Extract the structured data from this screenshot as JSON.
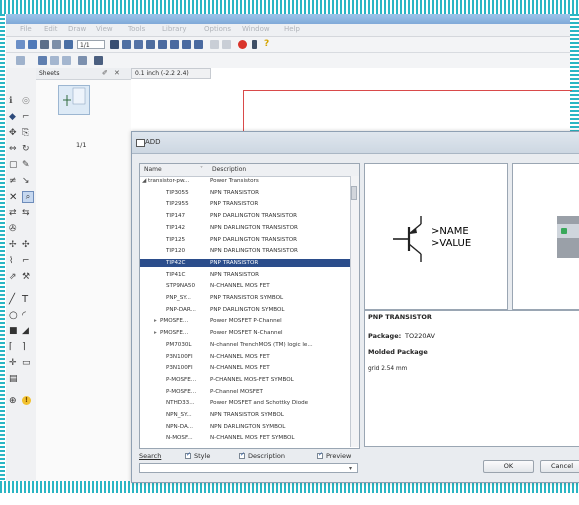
{
  "menu": [
    "File",
    "Edit",
    "Draw",
    "View",
    "Tools",
    "Library",
    "Options",
    "Window",
    "Help"
  ],
  "toolbar": {
    "zoom_value": "1/1"
  },
  "sheets_panel": {
    "title": "Sheets",
    "sheet_number": "1/1"
  },
  "canvas": {
    "coordinate_readout": "0.1 inch (-2.2 2.4)"
  },
  "dialog": {
    "title": "ADD",
    "columns": {
      "name": "Name",
      "description": "Description"
    },
    "rows": [
      {
        "name": "transistor-pw...",
        "description": "Power Transistors",
        "kind": "group"
      },
      {
        "name": "TIP3055",
        "description": "NPN TRANSISTOR"
      },
      {
        "name": "TIP2955",
        "description": "PNP TRANSISTOR"
      },
      {
        "name": "TIP147",
        "description": "PNP DARLINGTON TRANSISTOR"
      },
      {
        "name": "TIP142",
        "description": "NPN DARLINGTON TRANSISTOR"
      },
      {
        "name": "TIP125",
        "description": "PNP DARLINGTON TRANSISTOR"
      },
      {
        "name": "TIP120",
        "description": "NPN DARLINGTON TRANSISTOR"
      },
      {
        "name": "TIP42C",
        "description": "PNP TRANSISTOR",
        "selected": true
      },
      {
        "name": "TIP41C",
        "description": "NPN TRANSISTOR"
      },
      {
        "name": "STP9NA50",
        "description": "N-CHANNEL MOS FET"
      },
      {
        "name": "PNP_SY...",
        "description": "PNP TRANSISTOR SYMBOL"
      },
      {
        "name": "PNP-DAR...",
        "description": "PNP DARLINGTON SYMBOL"
      },
      {
        "name": "PMOSFE...",
        "description": "Power MOSFET P-Channel",
        "kind": "sub"
      },
      {
        "name": "PMOSFE...",
        "description": "Power MOSFET N-Channel",
        "kind": "sub"
      },
      {
        "name": "PM7030L",
        "description": "N-channel TrenchMOS (TM) logic le..."
      },
      {
        "name": "P3N100FI",
        "description": "N-CHANNEL MOS FET"
      },
      {
        "name": "P3N100FI",
        "description": "N-CHANNEL MOS FET"
      },
      {
        "name": "P-MOSFE...",
        "description": "P-CHANNEL MOS-FET SYMBOL"
      },
      {
        "name": "P-MOSFE...",
        "description": "P-Channel MOSFET"
      },
      {
        "name": "NTHD33...",
        "description": "Power MOSFET and Schottky Diode"
      },
      {
        "name": "NPN_SY...",
        "description": "NPN TRANSISTOR SYMBOL"
      },
      {
        "name": "NPN-DA...",
        "description": "NPN DARLINGTON SYMBOL"
      },
      {
        "name": "N-MOSF...",
        "description": "N-CHANNEL MOS FET SYMBOL"
      }
    ],
    "search_label": "Search",
    "checkboxes": [
      "Style",
      "Description",
      "Preview"
    ],
    "preview_symbol_text": [
      ">NAME",
      ">VALUE"
    ],
    "info": {
      "title": "PNP TRANSISTOR",
      "package_label": "Package:",
      "package_value": "TO220AV",
      "molded_label": "Molded Package",
      "grid": "grid 2.54 mm"
    },
    "ok_label": "OK",
    "cancel_label": "Cancel",
    "colors": {
      "selection": "#2b4d8b",
      "preview_symbol": "#8c8c96"
    }
  }
}
